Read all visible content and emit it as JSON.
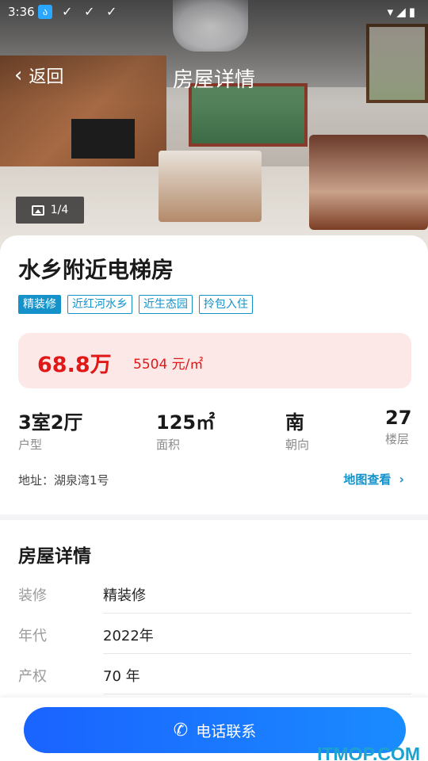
{
  "status_bar": {
    "time": "3:36"
  },
  "header": {
    "back_label": "返回",
    "title": "房屋详情"
  },
  "gallery": {
    "counter": "1/4"
  },
  "house": {
    "name": "水乡附近电梯房",
    "tags": [
      "精装修",
      "近红河水乡",
      "近生态园",
      "拎包入住"
    ],
    "price": "68.8万",
    "unit_price": "5504 元/㎡",
    "stats": [
      {
        "value": "3室2厅",
        "label": "户型"
      },
      {
        "value": "125㎡",
        "label": "面积"
      },
      {
        "value": "南",
        "label": "朝向"
      },
      {
        "value": "27",
        "label": "楼层"
      }
    ],
    "address": "地址：湖泉湾1号",
    "map_link": "地图查看"
  },
  "details": {
    "title": "房屋详情",
    "rows": [
      {
        "key": "装修",
        "value": "精装修"
      },
      {
        "key": "年代",
        "value": "2022年"
      },
      {
        "key": "产权",
        "value": "70 年"
      }
    ]
  },
  "actions": {
    "call_label": "电话联系"
  },
  "watermark": "ITMOP.COM",
  "colors": {
    "accent": "#1592c9",
    "price": "#e01818",
    "price_bg": "#fde8e8",
    "button": "#1a63ff"
  }
}
